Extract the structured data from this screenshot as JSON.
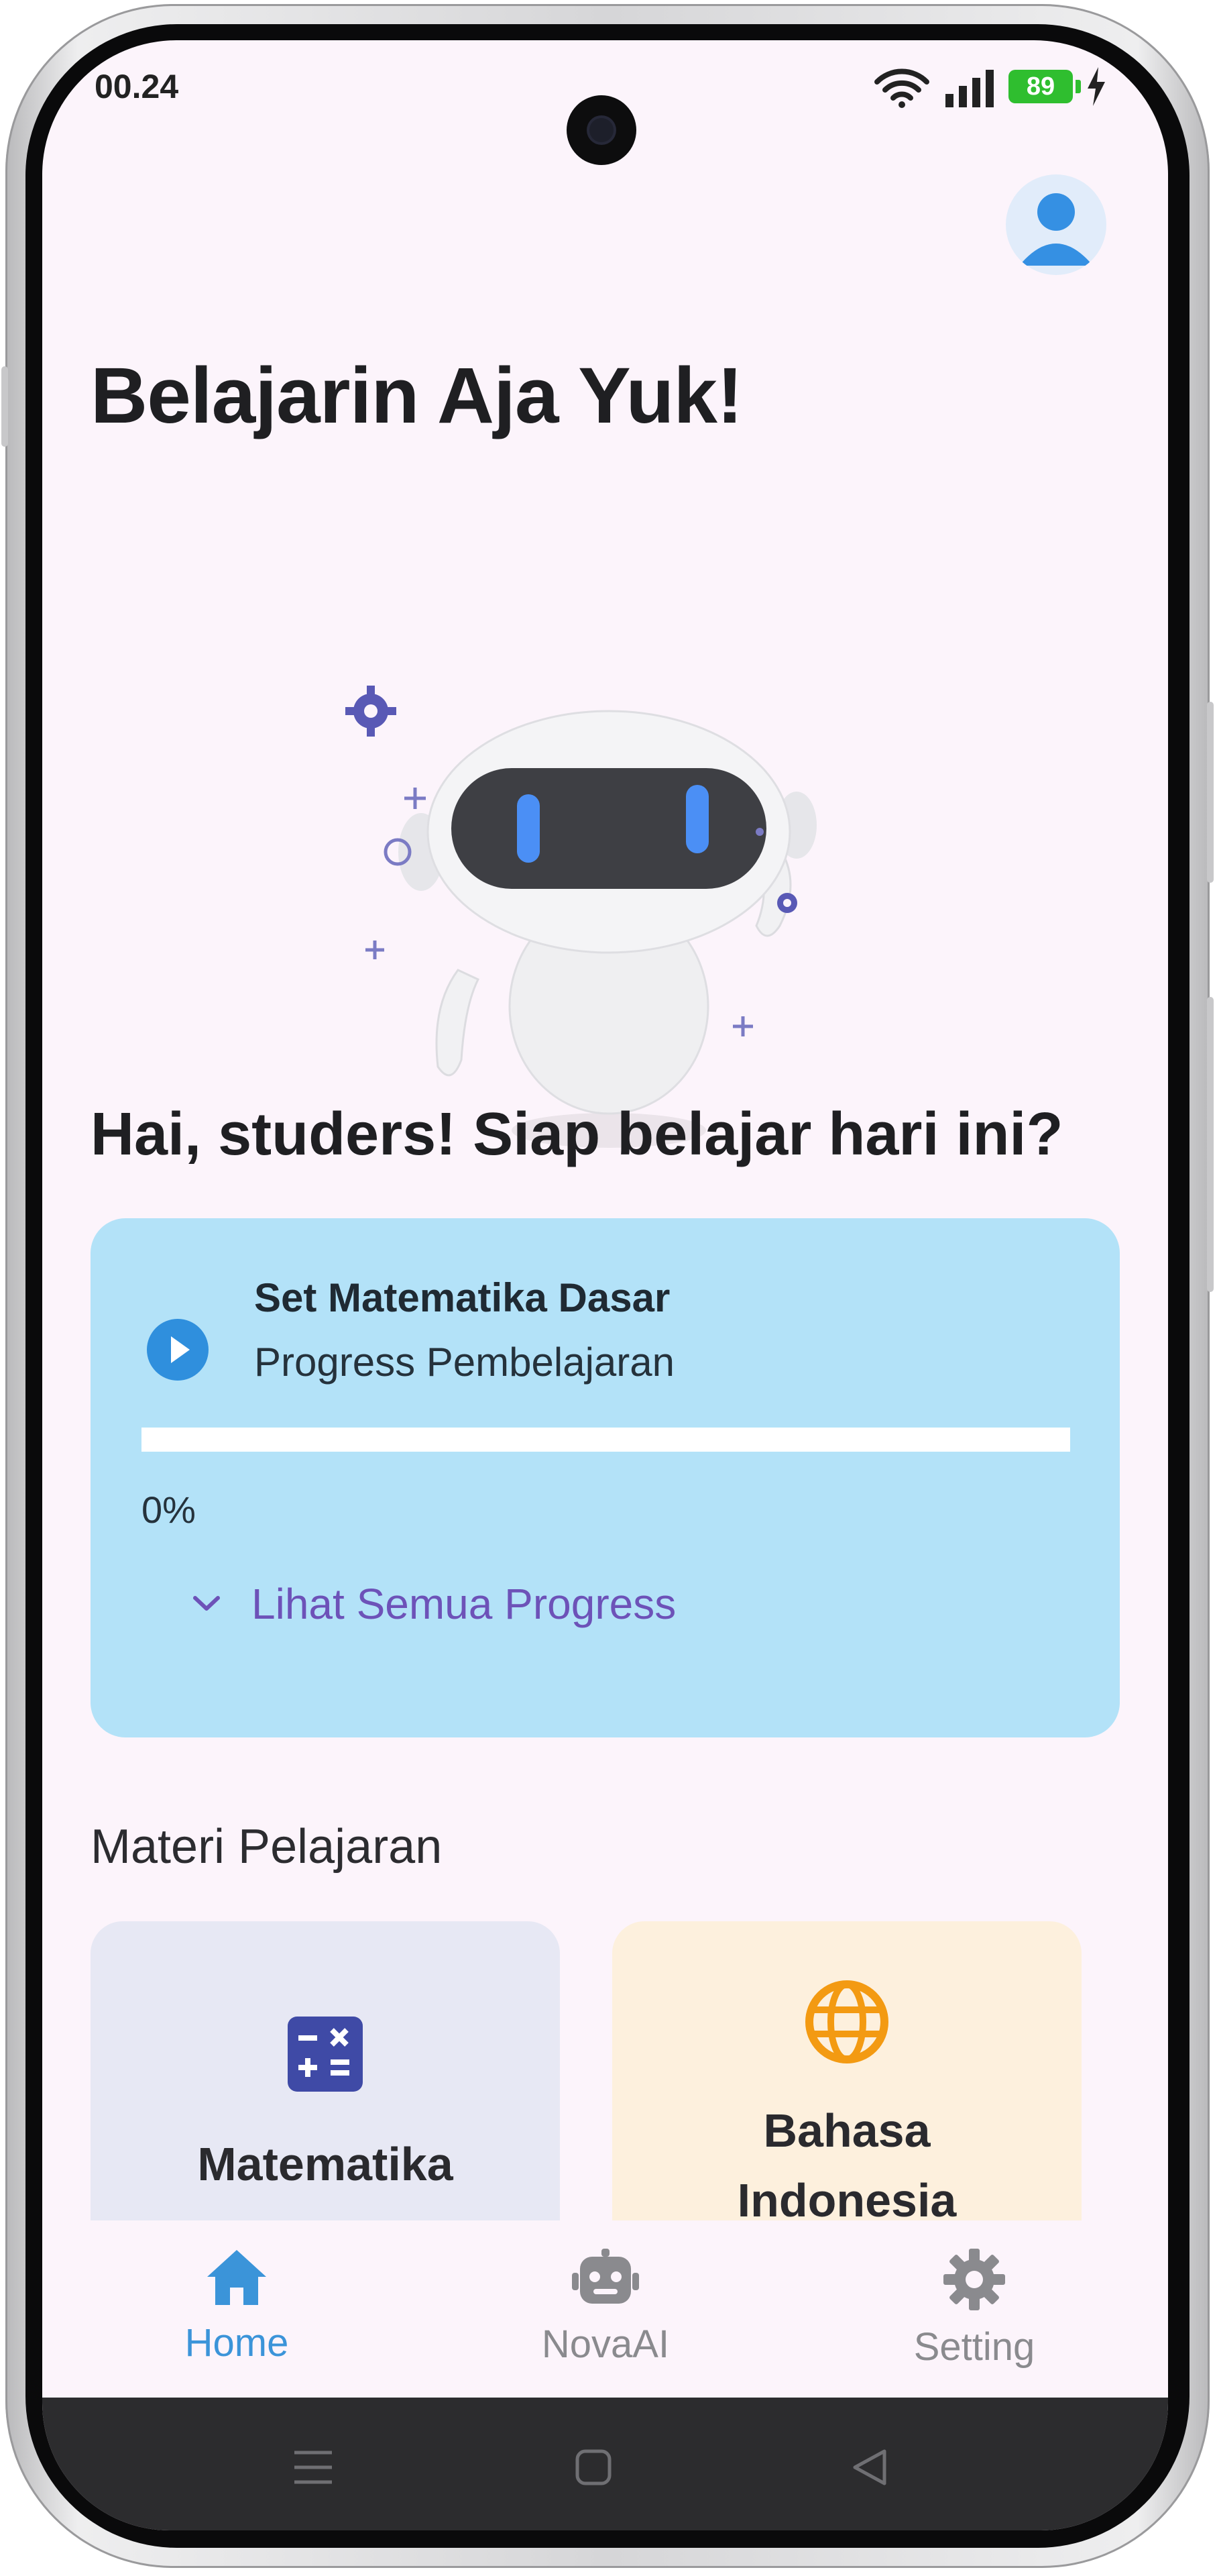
{
  "status_bar": {
    "time": "00.24",
    "battery": "89"
  },
  "header": {
    "title": "Belajarin Aja Yuk!",
    "profile_icon": "person-icon"
  },
  "greeting": "Hai, studers! Siap belajar hari ini?",
  "progress_card": {
    "title": "Set Matematika Dasar",
    "subtitle": "Progress Pembelajaran",
    "progress": 0,
    "percent_label": "0%",
    "see_all_label": "Lihat Semua Progress"
  },
  "materials": {
    "section_title": "Materi Pelajaran",
    "items": [
      {
        "label": "Matematika",
        "icon": "calculator-icon",
        "color": "#3f4aa6"
      },
      {
        "label_line1": "Bahasa",
        "label_line2": "Indonesia",
        "icon": "globe-icon",
        "color": "#f39a12"
      }
    ]
  },
  "bottom_nav": [
    {
      "label": "Home",
      "icon": "home-icon",
      "active": true
    },
    {
      "label": "NovaAI",
      "icon": "robot-icon",
      "active": false
    },
    {
      "label": "Setting",
      "icon": "gear-icon",
      "active": false
    }
  ],
  "colors": {
    "background": "#fcf4fb",
    "progress_card": "#b3e2f8",
    "accent_blue": "#2f8fdd",
    "link_purple": "#6d52b8",
    "nav_active": "#3b94d9",
    "nav_inactive": "#8a8a8e"
  }
}
